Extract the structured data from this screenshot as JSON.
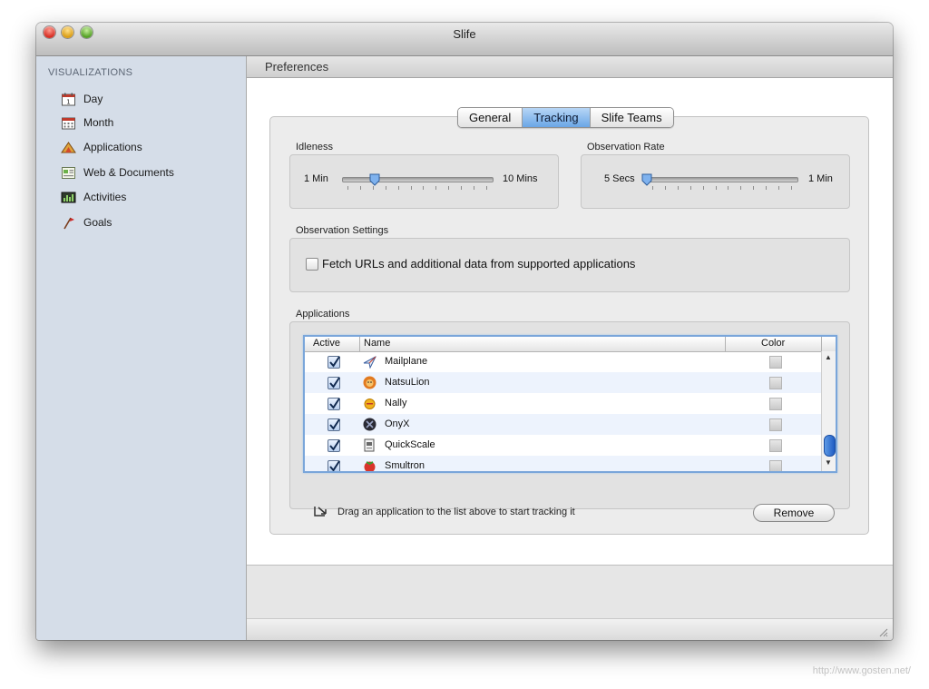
{
  "window": {
    "title": "Slife"
  },
  "sidebar": {
    "heading": "VISUALIZATIONS",
    "items": [
      {
        "label": "Day",
        "icon": "calendar-day-icon"
      },
      {
        "label": "Month",
        "icon": "calendar-month-icon"
      },
      {
        "label": "Applications",
        "icon": "applications-icon"
      },
      {
        "label": "Web & Documents",
        "icon": "web-documents-icon"
      },
      {
        "label": "Activities",
        "icon": "activities-icon"
      },
      {
        "label": "Goals",
        "icon": "goals-flag-icon"
      }
    ]
  },
  "content": {
    "header": "Preferences",
    "tabs": [
      {
        "label": "General",
        "selected": false
      },
      {
        "label": "Tracking",
        "selected": true
      },
      {
        "label": "Slife Teams",
        "selected": false
      }
    ],
    "idleness": {
      "label": "Idleness",
      "min_label": "1 Min",
      "max_label": "10 Mins",
      "value_fraction": 0.22
    },
    "observation_rate": {
      "label": "Observation Rate",
      "min_label": "5 Secs",
      "max_label": "1 Min",
      "value_fraction": 0.0
    },
    "observation_settings": {
      "label": "Observation Settings",
      "fetch_urls": {
        "label": "Fetch URLs and additional data from supported applications",
        "checked": false
      }
    },
    "applications": {
      "label": "Applications",
      "columns": [
        "Active",
        "Name",
        "Color"
      ],
      "rows": [
        {
          "active": true,
          "name": "Mailplane",
          "icon": "mailplane-icon"
        },
        {
          "active": true,
          "name": "NatsuLion",
          "icon": "natsulion-icon"
        },
        {
          "active": true,
          "name": "Nally",
          "icon": "nally-icon"
        },
        {
          "active": true,
          "name": "OnyX",
          "icon": "onyx-icon"
        },
        {
          "active": true,
          "name": "QuickScale",
          "icon": "quickscale-icon"
        },
        {
          "active": true,
          "name": "Smultron",
          "icon": "smultron-icon"
        }
      ],
      "drag_hint": "Drag an application to the list above to start tracking it",
      "remove_label": "Remove"
    }
  },
  "watermark": "http://www.gosten.net/",
  "colors": {
    "sidebar_bg": "#d5dde8",
    "tab_selected": "#6aa6e6",
    "table_focus": "#7aa6da",
    "row_alt": "#edf3fd"
  }
}
